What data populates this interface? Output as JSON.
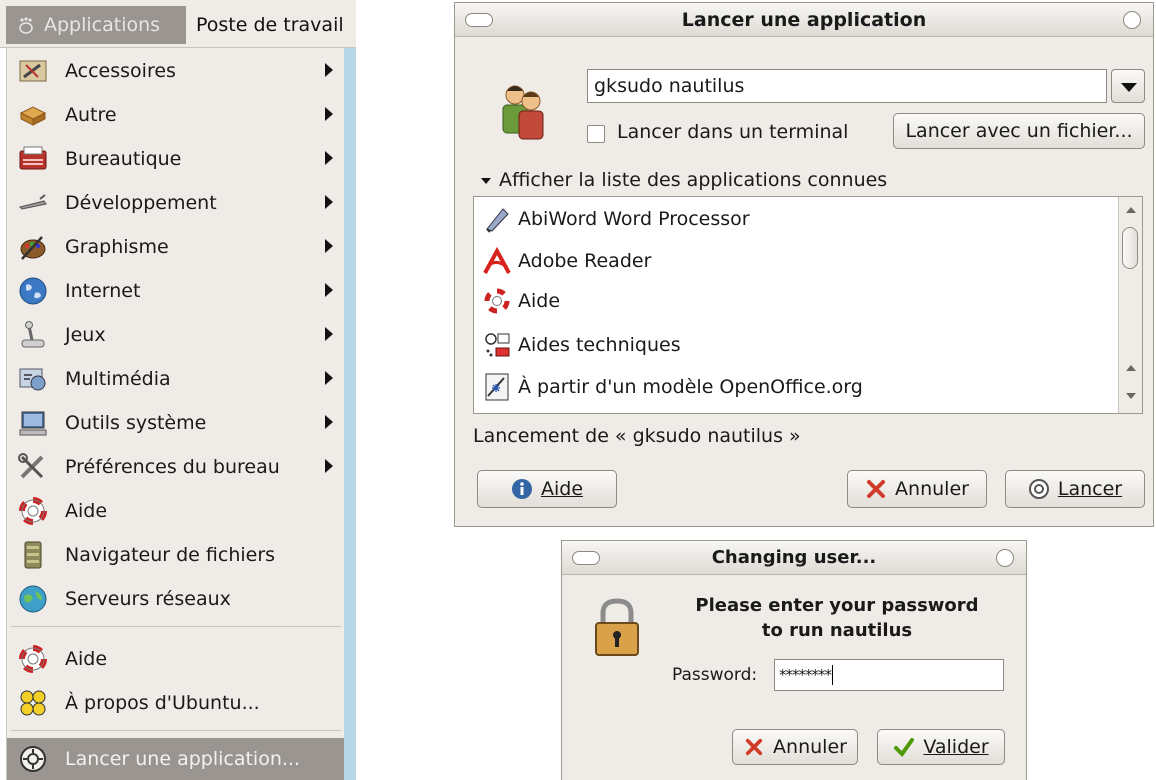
{
  "menubar": {
    "applications_label": "Applications",
    "poste_label": "Poste de travail"
  },
  "menu": {
    "items": [
      {
        "label": "Accessoires",
        "icon": "accessories-icon",
        "submenu": true
      },
      {
        "label": "Autre",
        "icon": "other-icon",
        "submenu": true
      },
      {
        "label": "Bureautique",
        "icon": "office-icon",
        "submenu": true
      },
      {
        "label": "Développement",
        "icon": "development-icon",
        "submenu": true
      },
      {
        "label": "Graphisme",
        "icon": "graphics-icon",
        "submenu": true
      },
      {
        "label": "Internet",
        "icon": "internet-globe-icon",
        "submenu": true
      },
      {
        "label": "Jeux",
        "icon": "games-joystick-icon",
        "submenu": true
      },
      {
        "label": "Multimédia",
        "icon": "multimedia-icon",
        "submenu": true
      },
      {
        "label": "Outils système",
        "icon": "system-tools-icon",
        "submenu": true
      },
      {
        "label": "Préférences du bureau",
        "icon": "desktop-preferences-icon",
        "submenu": true
      },
      {
        "label": "Aide",
        "icon": "help-lifebuoy-icon",
        "submenu": false
      },
      {
        "label": "Navigateur de fichiers",
        "icon": "file-browser-icon",
        "submenu": false
      },
      {
        "label": "Serveurs réseaux",
        "icon": "network-servers-icon",
        "submenu": false
      }
    ],
    "bottom_items": [
      {
        "label": "Aide",
        "icon": "help-lifebuoy-icon"
      },
      {
        "label": "À propos d'Ubuntu...",
        "icon": "ubuntu-about-icon"
      }
    ],
    "run_item": {
      "label": "Lancer une application...",
      "icon": "run-gear-icon"
    }
  },
  "run_dialog": {
    "title": "Lancer une application",
    "command_value": "gksudo nautilus",
    "terminal_checkbox_label": "Lancer dans un terminal",
    "terminal_checked": false,
    "run_with_file_button": "Lancer avec un fichier...",
    "expander_label": "Afficher la liste des applications connues",
    "apps": [
      {
        "label": "AbiWord Word Processor",
        "icon": "abiword-icon"
      },
      {
        "label": "Adobe Reader",
        "icon": "adobe-reader-icon"
      },
      {
        "label": "Aide",
        "icon": "help-lifebuoy-icon"
      },
      {
        "label": "Aides techniques",
        "icon": "assistive-technology-icon"
      },
      {
        "label": "À partir d'un modèle OpenOffice.org",
        "icon": "openoffice-template-icon"
      }
    ],
    "status_text": "Lancement de « gksudo nautilus »",
    "help_button": "Aide",
    "cancel_button": "Annuler",
    "run_button": "Lancer"
  },
  "password_dialog": {
    "title": "Changing user...",
    "message_line1": "Please enter your password",
    "message_line2": "to run nautilus",
    "password_label": "Password:",
    "password_value": "********",
    "cancel_button": "Annuler",
    "ok_button": "Valider"
  },
  "colors": {
    "menu_bg": "#efebe7",
    "selected_bg": "#9a9590",
    "cancel_red": "#d03c2a",
    "ok_green": "#4e9a06",
    "info_blue": "#3465a4"
  }
}
